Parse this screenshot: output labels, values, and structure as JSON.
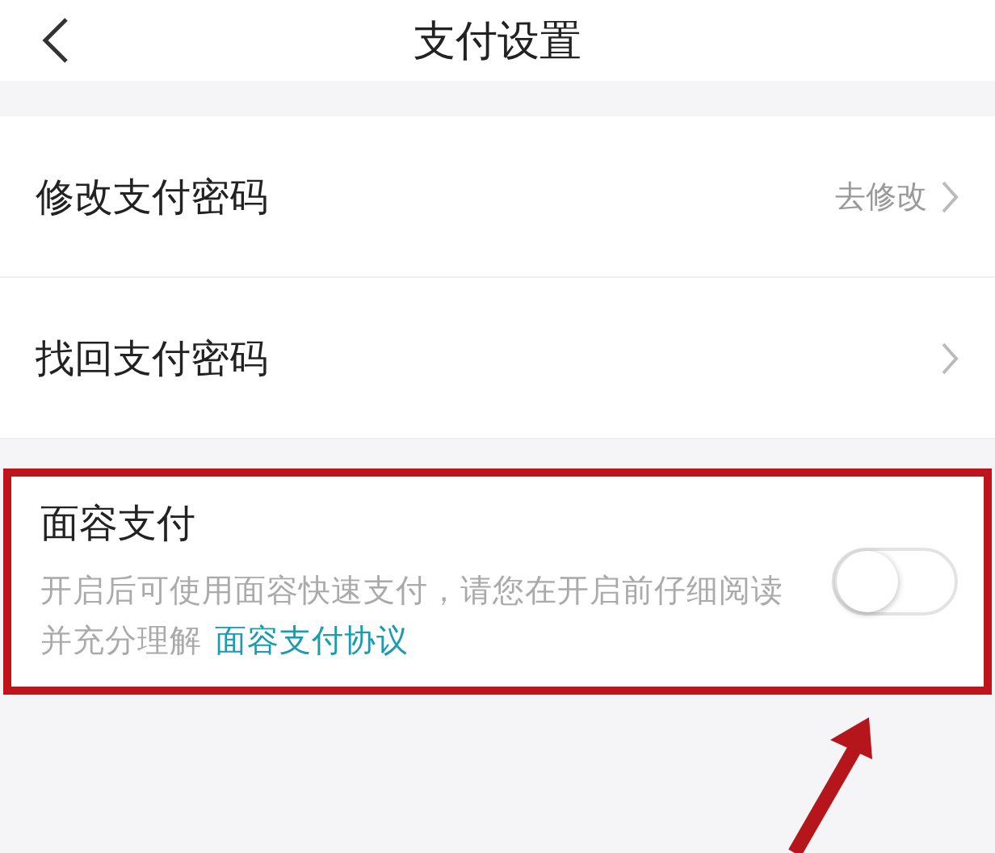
{
  "nav": {
    "title": "支付设置"
  },
  "rows": [
    {
      "label": "修改支付密码",
      "action": "去修改"
    },
    {
      "label": "找回支付密码"
    }
  ],
  "face_pay": {
    "title": "面容支付",
    "description": "开启后可使用面容快速支付，请您在开启前仔细阅读并充分理解",
    "link": "面容支付协议",
    "on": false
  }
}
